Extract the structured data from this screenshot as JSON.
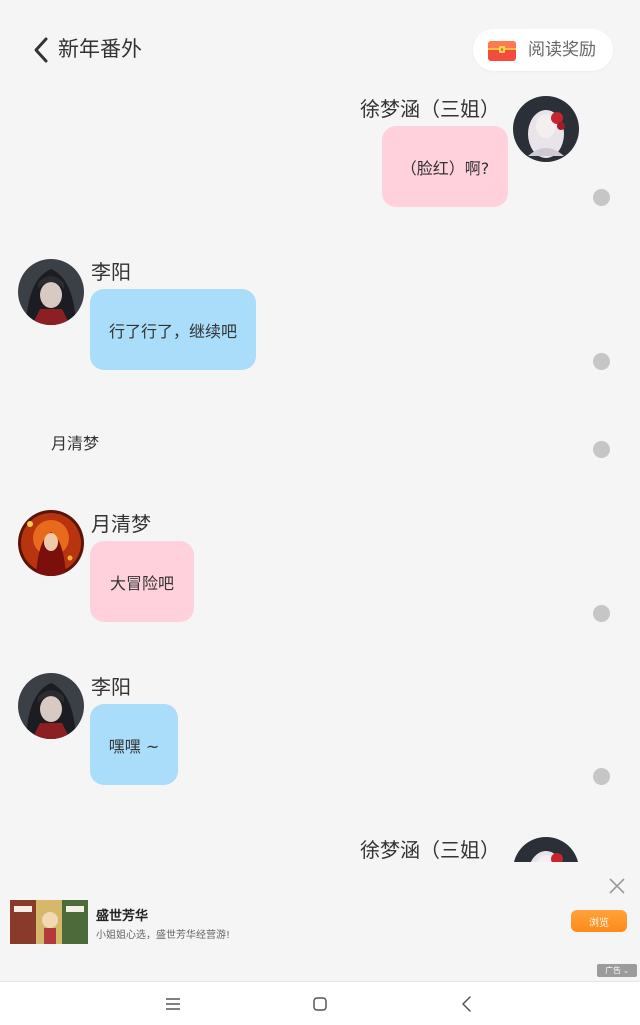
{
  "header": {
    "title": "新年番外",
    "reward_label": "阅读奖励"
  },
  "messages": [
    {
      "speaker": "徐梦涵（三姐）",
      "text": "（脸红）啊?",
      "side": "right",
      "bubble_color": "#ffd1dc"
    },
    {
      "speaker": "李阳",
      "text": "行了行了，继续吧",
      "side": "left",
      "bubble_color": "#a9ddfa"
    },
    {
      "narration": "月清梦"
    },
    {
      "speaker": "月清梦",
      "text": "大冒险吧",
      "side": "left",
      "bubble_color": "#ffd1dc"
    },
    {
      "speaker": "李阳",
      "text": "嘿嘿 ~",
      "side": "left",
      "bubble_color": "#a9ddfa"
    },
    {
      "speaker": "徐梦涵（三姐）",
      "side": "right"
    }
  ],
  "ad": {
    "title": "盛世芳华",
    "description": "小姐姐心选，盛世芳华经营游!",
    "button_label": "浏览",
    "badge": "广告",
    "accent_color": "#ff8a1a"
  },
  "navbar": {
    "icons": [
      "menu-icon",
      "home-square-icon",
      "back-chevron-icon"
    ]
  }
}
